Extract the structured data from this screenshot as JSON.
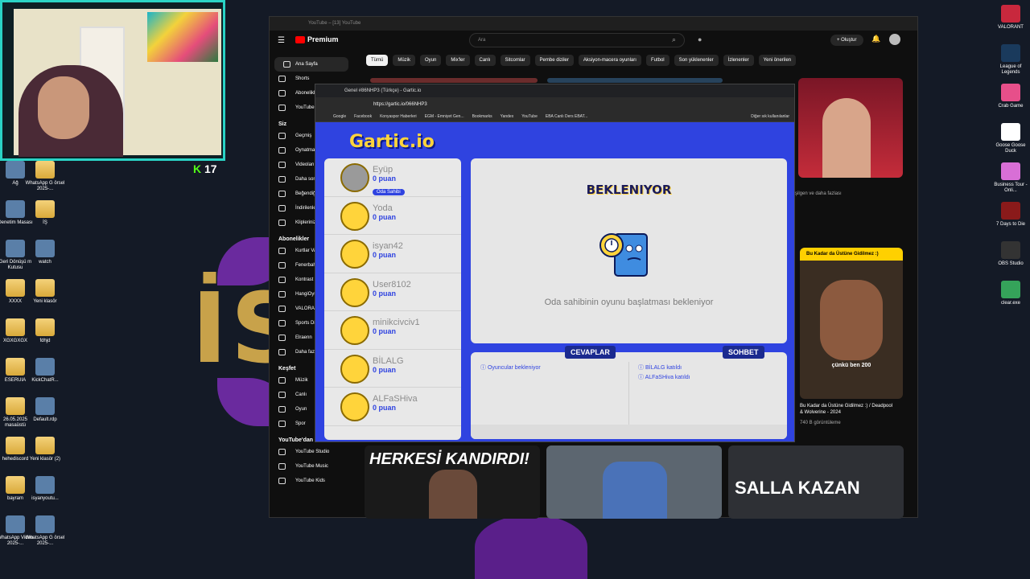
{
  "desktop": {
    "icons_left": [
      {
        "label": "Ağ"
      },
      {
        "label": "WhatsApp G örsel 2025-..."
      },
      {
        "label": "Denetim Masası"
      },
      {
        "label": "İŞ"
      },
      {
        "label": "Geri Dönüşü m Kutusu"
      },
      {
        "label": "watch"
      },
      {
        "label": "XXXX"
      },
      {
        "label": "Yeni klasör"
      },
      {
        "label": "XGXGXGX"
      },
      {
        "label": "fdhjd"
      },
      {
        "label": "ESERUIA"
      },
      {
        "label": "KickChatR..."
      },
      {
        "label": "26.05.2025 masaüstü"
      },
      {
        "label": "Default.rdp"
      },
      {
        "label": "hehediscord"
      },
      {
        "label": "Yeni klasör (2)"
      },
      {
        "label": "bayram"
      },
      {
        "label": "isyanyoutu..."
      },
      {
        "label": "WhatsApp Video 2025-..."
      },
      {
        "label": "WhatsApp G örsel 2025-..."
      }
    ],
    "icons_right": [
      {
        "label": "VALORANT"
      },
      {
        "label": "League of Legends"
      },
      {
        "label": "Crab Game"
      },
      {
        "label": "Goose Goose Duck"
      },
      {
        "label": "Business Tour - Onli..."
      },
      {
        "label": "7 Days to Die"
      },
      {
        "label": "OBS Studio"
      },
      {
        "label": "clear.exe"
      }
    ],
    "bg_text": "İS",
    "kick_overlay": "17"
  },
  "youtube": {
    "window_title": "YouTube – [13] YouTube",
    "logo": "Premium",
    "search_placeholder": "Ara",
    "create_label": "Oluştur",
    "chips": [
      "Tümü",
      "Müzik",
      "Oyun",
      "Mix'ler",
      "Canlı",
      "Sitcomlar",
      "Pembe diziler",
      "Aksiyon-macera oyunları",
      "Futbol",
      "Son yüklenenler",
      "İzlenenler",
      "Yeni önerilen"
    ],
    "sidebar_main": [
      "Ana Sayfa",
      "Shorts",
      "Abonelikler",
      "YouTube Music"
    ],
    "sidebar_you_header": "Siz",
    "sidebar_you": [
      "Geçmiş",
      "Oynatma listeleri",
      "Videolarınız",
      "Daha sonra izle",
      "Beğendiğiniz videolar",
      "İndirilenler",
      "Klipleriniz"
    ],
    "sidebar_subs_header": "Abonelikler",
    "sidebar_subs": [
      "Kurtlar Vadisi",
      "Fenerbahçe",
      "Kontrast",
      "HangiOyun",
      "VALORANT",
      "Sports Digest",
      "Elraenn",
      "Daha fazla göster"
    ],
    "sidebar_explore_header": "Keşfet",
    "sidebar_explore": [
      "Müzik",
      "Canlı",
      "Oyun",
      "Spor"
    ],
    "sidebar_more_header": "YouTube'dan daha fazla...",
    "sidebar_more": [
      "YouTube Studio",
      "YouTube Music",
      "YouTube Kids"
    ],
    "partial_title": "şilgen ve daha fazlası",
    "short_card": {
      "overlay_top": "Bu Kadar da Üstüne Gidilmez :)",
      "overlay_caption": "çünkü ben 200",
      "title": "Bu Kadar da Üstüne Gidilmez :) / Deadpool & Wolverine - 2024",
      "views": "740 B görüntüleme"
    },
    "bottom_thumbs": [
      "HERKESİ KANDIRDI!",
      "",
      "SALLA KAZAN"
    ]
  },
  "browser": {
    "tab_title": "Genel #86NHP3 (Türkçe) - Gartic.io",
    "url": "https://gartic.io/066NHP3",
    "bookmarks": [
      "Google",
      "Facebook",
      "Konyaspor Haberleri",
      "EGM - Emniyet Gen...",
      "Bookmarks",
      "Yandex",
      "YouTube",
      "EBA Canlı Ders EBAT..."
    ],
    "bookmarks_other": "Diğer sık kullanılanlar"
  },
  "gartic": {
    "logo": "Gartic.io",
    "players": [
      {
        "name": "Eyüp",
        "points": "0 puan",
        "badge": "Oda Sahibi"
      },
      {
        "name": "Yoda",
        "points": "0 puan"
      },
      {
        "name": "isyan42",
        "points": "0 puan"
      },
      {
        "name": "User8102",
        "points": "0 puan"
      },
      {
        "name": "minikcivciv1",
        "points": "0 puan"
      },
      {
        "name": "BİLALG",
        "points": "0 puan"
      },
      {
        "name": "ALFaSHiva",
        "points": "0 puan"
      }
    ],
    "status_title": "BEKLENIYOR",
    "status_msg": "Oda sahibinin oyunu başlatması bekleniyor",
    "answers_label": "CEVAPLAR",
    "chat_label": "SOHBET",
    "answers_info": "Oyuncular bekleniyor",
    "chat_messages": [
      "BİLALG katıldı",
      "ALFaSHiva katıldı"
    ],
    "colors": {
      "primary": "#2f43e0",
      "accent": "#ffd43b"
    }
  }
}
